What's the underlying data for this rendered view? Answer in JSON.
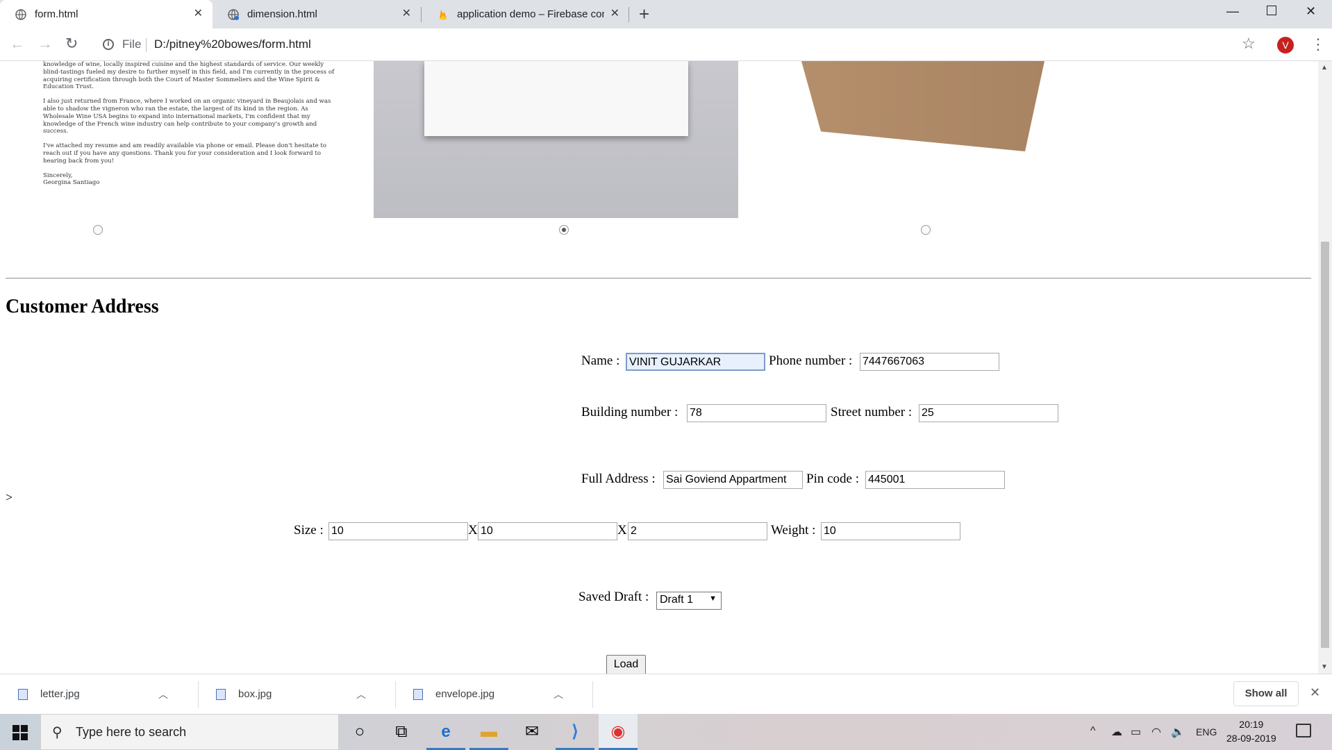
{
  "browser": {
    "tabs": [
      {
        "title": "form.html",
        "active": true
      },
      {
        "title": "dimension.html",
        "active": false
      },
      {
        "title": "application demo – Firebase con",
        "active": false
      }
    ],
    "url_scheme": "File",
    "url": "D:/pitney%20bowes/form.html",
    "profile_initial": "V"
  },
  "page": {
    "letter_image": {
      "paragraphs": [
        "knowledge of wine, locally inspired cuisine and the highest standards of service. Our weekly blind-tastings fueled my desire to further myself in this field, and I'm currently in the process of acquiring certification through both the Court of Master Sommeliers and the Wine Spirit & Education Trust.",
        "I also just returned from France, where I worked on an organic vineyard in Beaujolais and was able to shadow the vigneron who ran the estate, the largest of its kind in the region. As Wholesale Wine USA begins to expand into international markets, I'm confident that my knowledge of the French wine industry can help contribute to your company's growth and success.",
        "I've attached my resume and am readily available via phone or email. Please don't hesitate to reach out if you have any questions. Thank you for your consideration and I look forward to hearing back from you!",
        "Sincerely,\nGeorgina Santiago"
      ]
    },
    "package_choice": {
      "options": [
        "letter",
        "envelope",
        "box"
      ],
      "selected": "envelope"
    },
    "section_title": "Customer Address",
    "stray_text": ">",
    "form": {
      "name_label": "Name :",
      "name_value": "VINIT GUJARKAR",
      "phone_label": "Phone number :",
      "phone_value": "7447667063",
      "building_label": "Building number :",
      "building_value": "78",
      "street_label": "Street number :",
      "street_value": "25",
      "address_label": "Full Address :",
      "address_value": "Sai Goviend Appartment",
      "pin_label": "Pin code :",
      "pin_value": "445001",
      "size_label": "Size :",
      "size_x": "10",
      "size_sep1": "X",
      "size_y": "10",
      "size_sep2": "X",
      "size_z": "2",
      "weight_label": "Weight :",
      "weight_value": "10",
      "draft_label": "Saved Draft :",
      "draft_value": "Draft 1",
      "load_label": "Load"
    }
  },
  "downloads": {
    "items": [
      "letter.jpg",
      "box.jpg",
      "envelope.jpg"
    ],
    "show_all": "Show all"
  },
  "taskbar": {
    "search_placeholder": "Type here to search",
    "language": "ENG",
    "time": "20:19",
    "date": "28-09-2019"
  }
}
